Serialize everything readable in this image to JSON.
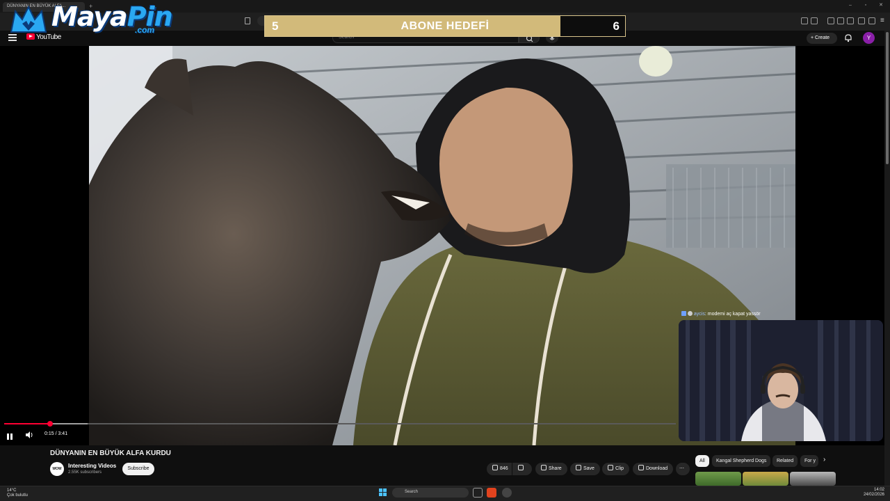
{
  "browser": {
    "tab_title": "DÜNYANIN EN BÜYÜK ALFA..."
  },
  "overlay": {
    "logo_word_a": "Maya",
    "logo_word_b": "Pin",
    "logo_suffix": ".com",
    "youtube_label": "YouTube",
    "goal": {
      "title": "ABONE HEDEFİ",
      "start": "5",
      "end": "6",
      "fill_fraction": 0.82
    }
  },
  "youtube": {
    "search_placeholder": "Search",
    "create_label": "Create",
    "avatar_letter": "Y"
  },
  "player": {
    "time": "0:15 / 3:41",
    "progress_fraction": 0.068
  },
  "chat": {
    "username": "aycis",
    "message": ": modemi aç kapat yassör"
  },
  "video": {
    "title": "DÜNYANIN EN BÜYÜK ALFA KURDU",
    "channel_avatar": "WOW",
    "channel_name": "Interesting Videos",
    "subscribers": "2.55K subscribers",
    "subscribe_label": "Subscribe",
    "likes": "846",
    "share_label": "Share",
    "save_label": "Save",
    "clip_label": "Clip",
    "download_label": "Download"
  },
  "related_chips": {
    "all": "All",
    "items": [
      "Kangal Shepherd Dogs",
      "Related",
      "For y"
    ]
  },
  "taskbar": {
    "weather_temp": "14°C",
    "weather_desc": "Çok bulutlu",
    "search_label": "Search",
    "time": "14:02",
    "date": "24/02/2026"
  },
  "colors": {
    "accent_red": "#ff0033",
    "goal_fill": "#d2ba7a",
    "logo_blue": "#2aa8f2"
  }
}
